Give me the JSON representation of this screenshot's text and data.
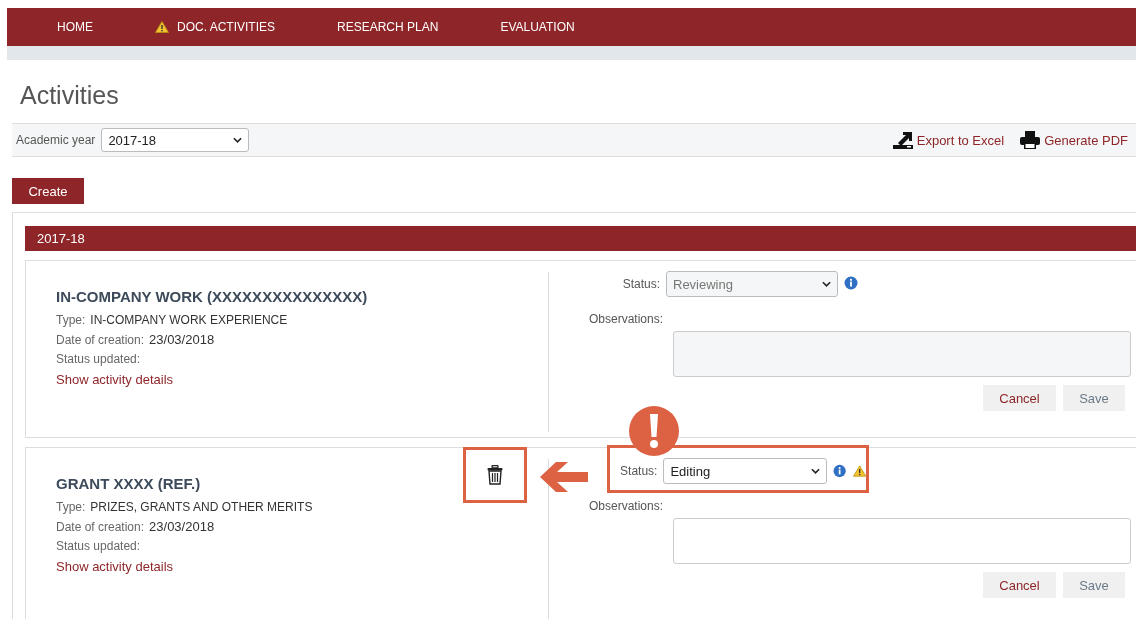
{
  "nav": [
    {
      "label": "HOME",
      "warning": false
    },
    {
      "label": "DOC. ACTIVITIES",
      "warning": true
    },
    {
      "label": "RESEARCH PLAN",
      "warning": false
    },
    {
      "label": "EVALUATION",
      "warning": false
    }
  ],
  "page_title": "Activities",
  "filter": {
    "label": "Academic year",
    "value": "2017-18"
  },
  "actions": [
    {
      "kind": "excel",
      "label": "Export to Excel"
    },
    {
      "kind": "pdf",
      "label": "Generate PDF"
    }
  ],
  "create_button": "Create",
  "section": {
    "title": "2017-18"
  },
  "activities": [
    {
      "title": "IN-COMPANY WORK (XXXXXXXXXXXXXXX)",
      "type_label": "Type:",
      "type": "IN-COMPANY WORK EXPERIENCE",
      "date_label": "Date of creation:",
      "date": "23/03/2018",
      "status_updated_label": "Status updated:",
      "details_link": "Show activity details",
      "status_label": "Status:",
      "status": "Reviewing",
      "editable": false,
      "warning": false,
      "deletable": false,
      "highlighted": false,
      "observations_label": "Observations:",
      "cancel": "Cancel",
      "save": "Save"
    },
    {
      "title": "GRANT XXXX (REF.)",
      "type_label": "Type:",
      "type": "PRIZES, GRANTS AND OTHER MERITS",
      "date_label": "Date of creation:",
      "date": "23/03/2018",
      "status_updated_label": "Status updated:",
      "details_link": "Show activity details",
      "status_label": "Status:",
      "status": "Editing",
      "editable": true,
      "warning": true,
      "deletable": true,
      "highlighted": true,
      "observations_label": "Observations:",
      "cancel": "Cancel",
      "save": "Save"
    }
  ]
}
